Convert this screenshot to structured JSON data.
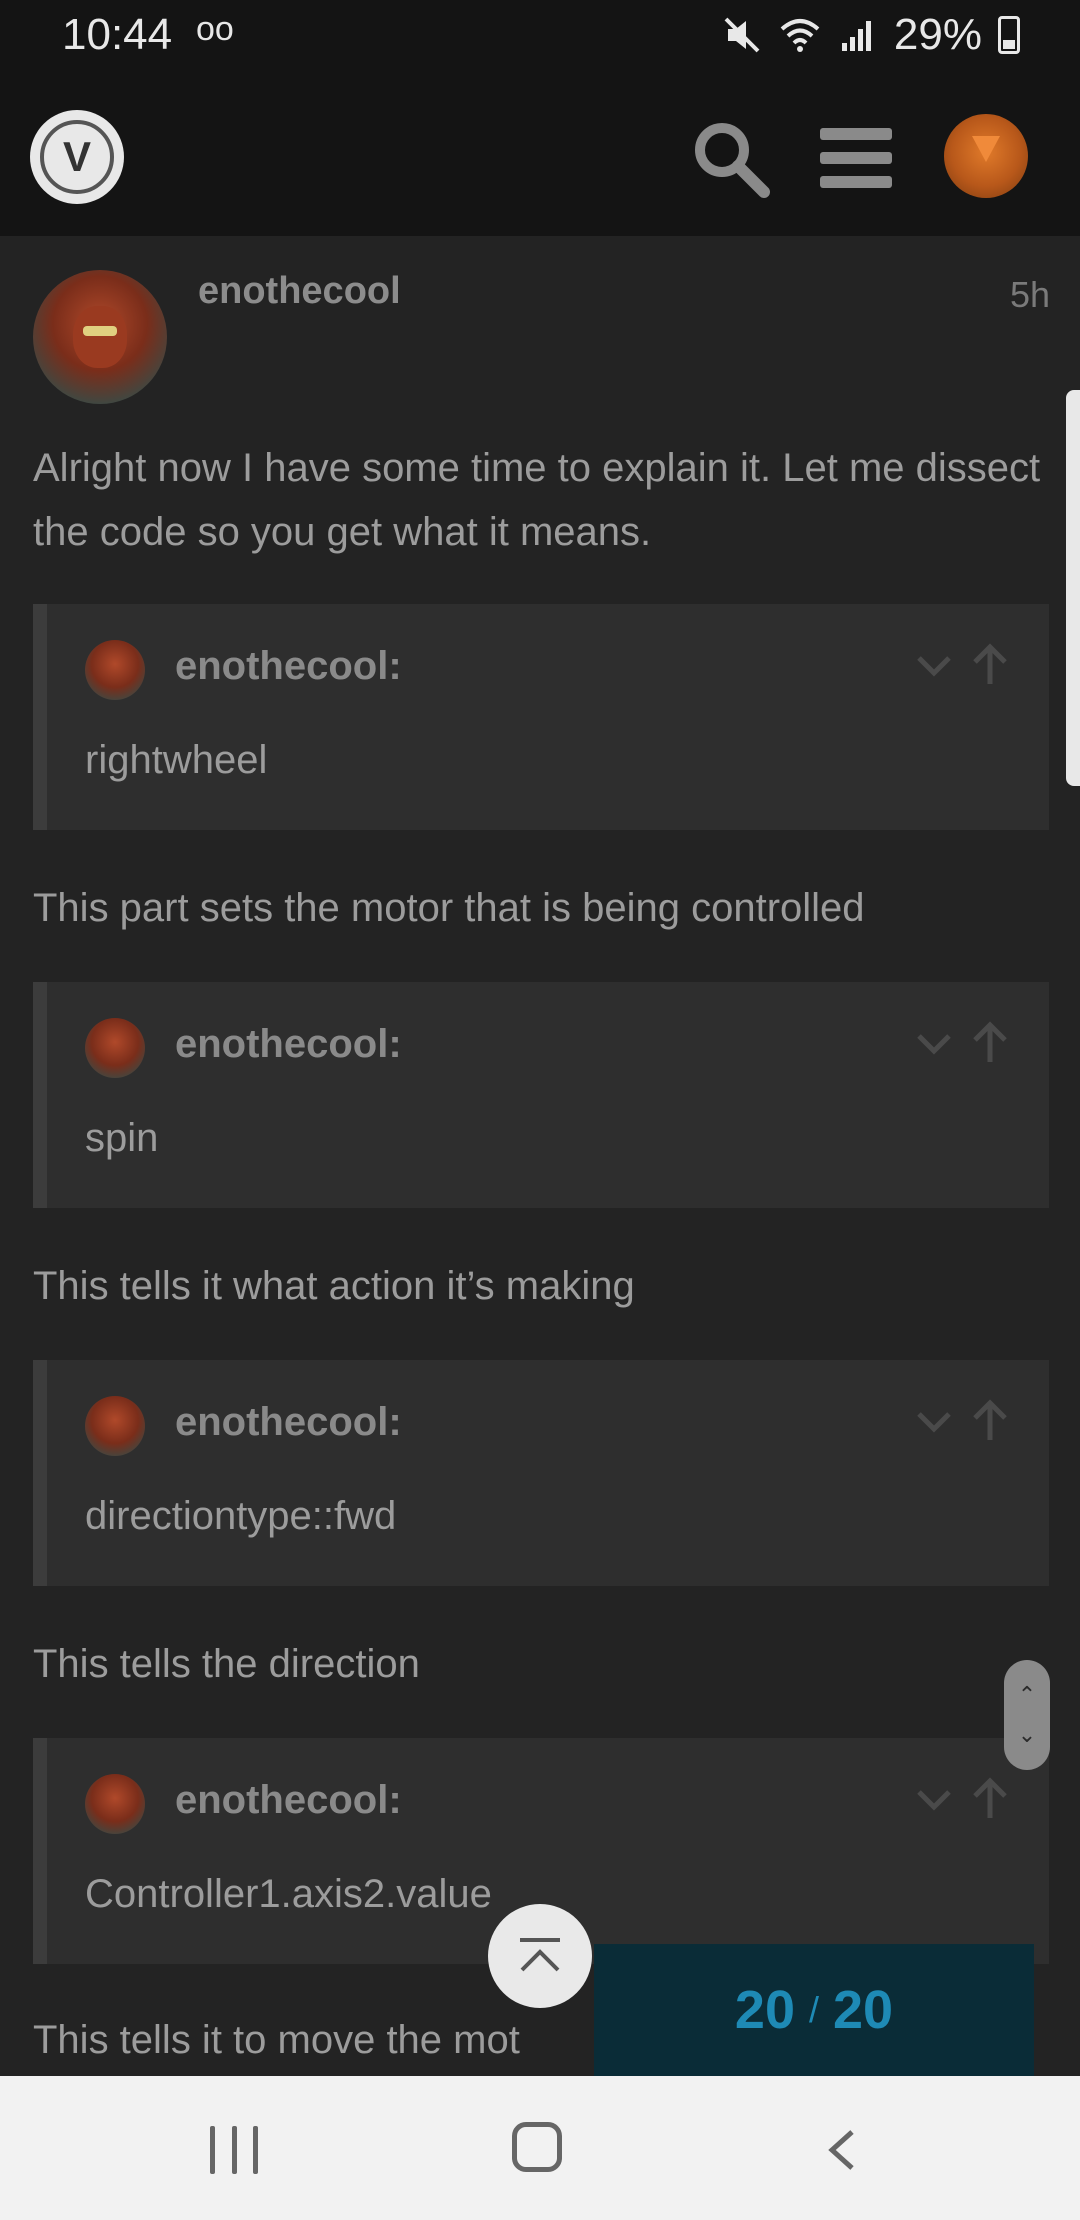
{
  "status_bar": {
    "time": "10:44",
    "voicemail_icon": "oo",
    "battery_percent": "29%",
    "icons": [
      "mute-icon",
      "wifi-icon",
      "signal-icon",
      "battery-icon"
    ]
  },
  "header": {
    "logo_icon": "site-logo",
    "icons": [
      "search-icon",
      "menu-icon",
      "user-avatar"
    ]
  },
  "post": {
    "username": "enothecool",
    "time": "5h",
    "intro": "Alright now I have some time to explain it. Let me dissect the code so you get what it means.",
    "quotes": [
      {
        "user": "enothecool:",
        "text": "rightwheel",
        "after": "This part sets the motor that is being controlled"
      },
      {
        "user": "enothecool:",
        "text": "spin",
        "after": "This tells it what action it’s making"
      },
      {
        "user": "enothecool:",
        "text": "directiontype::fwd",
        "after": "This tells the direction"
      },
      {
        "user": "enothecool:",
        "text": "Controller1.axis2.value",
        "after": "This tells it to move the mot"
      }
    ]
  },
  "progress": {
    "current": "20",
    "separator": "/",
    "total": "20"
  },
  "colors": {
    "accent": "#1e8ab5",
    "background": "#232323",
    "header": "#141414",
    "quote_bg": "#2e2e2e"
  }
}
